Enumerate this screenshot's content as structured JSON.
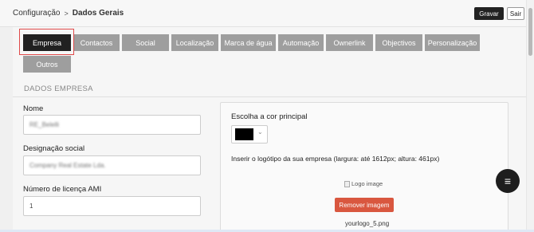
{
  "header": {
    "breadcrumb_parent": "Configuração",
    "breadcrumb_sep": ">",
    "breadcrumb_current": "Dados Gerais",
    "save_label": "Gravar",
    "exit_label": "Sair"
  },
  "tabs": [
    {
      "label": "Empresa",
      "active": true
    },
    {
      "label": "Contactos"
    },
    {
      "label": "Social"
    },
    {
      "label": "Localização"
    },
    {
      "label": "Marca de água"
    },
    {
      "label": "Automação"
    },
    {
      "label": "Ownerlink"
    },
    {
      "label": "Objectivos"
    },
    {
      "label": "Personalização"
    },
    {
      "label": "Outros"
    }
  ],
  "section_title": "DADOS EMPRESA",
  "form": {
    "name_label": "Nome",
    "name_value": "RE_Belelli",
    "social_label": "Designação social",
    "social_value": "Company Real Estate Lda.",
    "ami_label": "Número de licença AMI",
    "ami_value": "1"
  },
  "branding": {
    "color_label": "Escolha a cor principal",
    "color_value": "#000000",
    "chevron_icon": "chevron-down-icon",
    "logo_hint": "Inserir o logótipo da sua empresa (largura: até 1612px; altura: 461px)",
    "logo_alt": "Logo image",
    "remove_label": "Remover imagem",
    "filename": "yourlogo_5.png"
  },
  "fab_icon": "menu-icon",
  "colors": {
    "accent_red": "#d9573f",
    "dark": "#212121",
    "tab_grey": "#9e9e9e"
  }
}
